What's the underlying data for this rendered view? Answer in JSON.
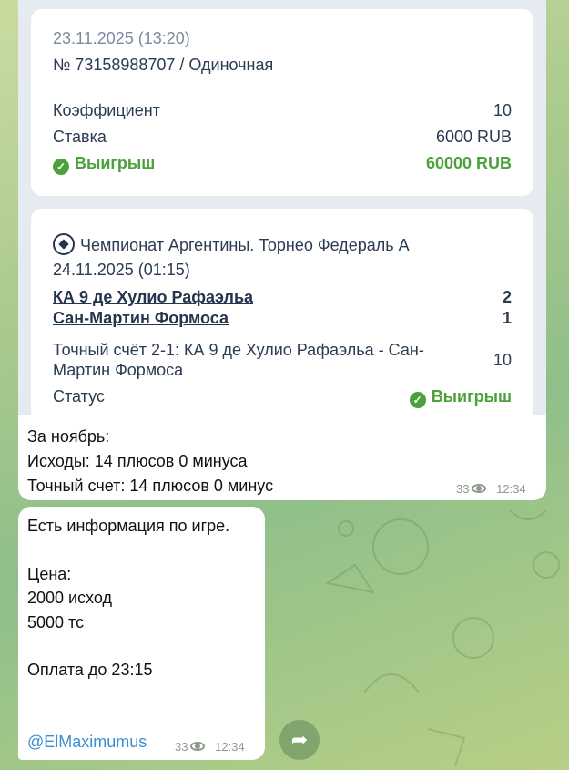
{
  "bet_ticket": {
    "date": "23.11.2025 (13:20)",
    "number_type": "№ 73158988707 / Одиночная",
    "coef_label": "Коэффициент",
    "coef_value": "10",
    "stake_label": "Ставка",
    "stake_value": "6000 RUB",
    "result_label": "Выигрыш",
    "result_value": "60000 RUB"
  },
  "event": {
    "league": "Чемпионат Аргентины. Торнео Федераль А",
    "date": "24.11.2025 (01:15)",
    "team1": "КА 9 де Хулио Рафаэльа",
    "team1_score": "2",
    "team2": "Сан-Мартин Формоса",
    "team2_score": "1",
    "market_line1": "Точный счёт 2-1: КА 9 де Хулио Рафаэльа - Сан-",
    "market_line2": "Мартин Формоса",
    "market_odds": "10",
    "status_label": "Статус",
    "status_value": "Выигрыш"
  },
  "message1": {
    "line1": "За ноябрь:",
    "line2": "Исходы: 14 плюсов 0 минуса",
    "line3": "Точный счет: 14 плюсов 0 минус",
    "views": "33",
    "time": "12:34"
  },
  "message2": {
    "line1": "Есть информация по игре.",
    "line2": "Цена:",
    "line3": "2000 исход",
    "line4": "5000 тс",
    "line5": "Оплата до 23:15",
    "link": "@ElMaximumus",
    "views": "33",
    "time": "12:34"
  },
  "icons": {
    "check": "check-circle-icon",
    "ball": "soccer-ball-icon",
    "eye": "eye-icon",
    "forward": "forward-icon"
  }
}
